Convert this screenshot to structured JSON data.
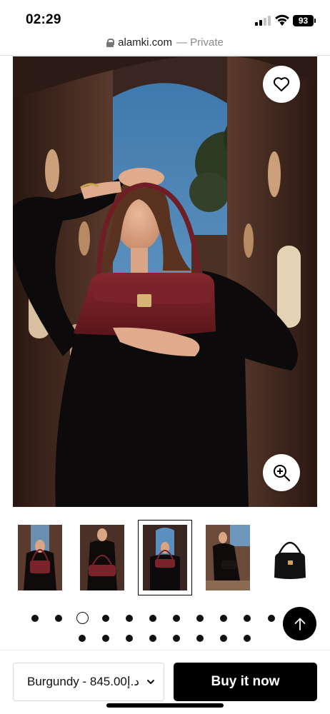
{
  "status_bar": {
    "time": "02:29",
    "battery": "93",
    "icons": [
      "cellular-signal-icon",
      "wifi-icon",
      "battery-icon"
    ]
  },
  "browser": {
    "domain": "alamki.com",
    "suffix": "— Private",
    "icons": [
      "lock-icon"
    ]
  },
  "product": {
    "main_image": "woman holding burgundy handbag above head in courtyard",
    "icons": [
      "heart-icon",
      "zoom-icon",
      "arrow-up-icon",
      "chevron-down-icon"
    ],
    "selected_thumbnail": 3,
    "thumbnail_count": 5,
    "active_dot": 3,
    "dot_count": 19
  },
  "purchase": {
    "variant": "Burgundy - 845.00د.إ",
    "buy_label": "Buy it now"
  },
  "colors": {
    "bag": "#6e1e24",
    "button": "#000000",
    "sky": "#5b8fbd"
  }
}
